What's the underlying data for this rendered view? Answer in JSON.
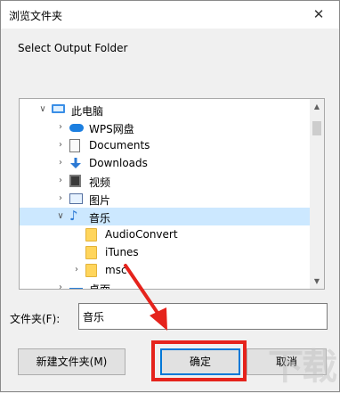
{
  "window": {
    "title": "浏览文件夹",
    "close_glyph": "✕"
  },
  "description": "Select Output Folder",
  "tree": {
    "items": [
      {
        "label": "此电脑",
        "icon": "computer-icon",
        "chevron": "∨",
        "level": 0
      },
      {
        "label": "WPS网盘",
        "icon": "cloud-icon",
        "chevron": "›",
        "level": 1
      },
      {
        "label": "Documents",
        "icon": "document-icon",
        "chevron": "›",
        "level": 1
      },
      {
        "label": "Downloads",
        "icon": "download-icon",
        "chevron": "›",
        "level": 1
      },
      {
        "label": "视频",
        "icon": "video-icon",
        "chevron": "›",
        "level": 1
      },
      {
        "label": "图片",
        "icon": "picture-icon",
        "chevron": "›",
        "level": 1
      },
      {
        "label": "音乐",
        "icon": "music-icon",
        "chevron": "∨",
        "level": 1,
        "selected": true
      },
      {
        "label": "AudioConvert",
        "icon": "folder-icon",
        "chevron": "",
        "level": 2
      },
      {
        "label": "iTunes",
        "icon": "folder-icon",
        "chevron": "",
        "level": 2
      },
      {
        "label": "msc",
        "icon": "folder-icon",
        "chevron": "›",
        "level": 2
      },
      {
        "label": "桌面",
        "icon": "desktop-icon",
        "chevron": "›",
        "level": 1
      }
    ],
    "scroll_up": "▲",
    "scroll_down": "▼"
  },
  "folder_field": {
    "label": "文件夹(F):",
    "value": "音乐"
  },
  "buttons": {
    "new_folder": "新建文件夹(M)",
    "ok": "确定",
    "cancel": "取消"
  },
  "watermark": "下载",
  "colors": {
    "selection": "#cce8ff",
    "accent": "#0078d7",
    "annotation": "#e5231c"
  }
}
